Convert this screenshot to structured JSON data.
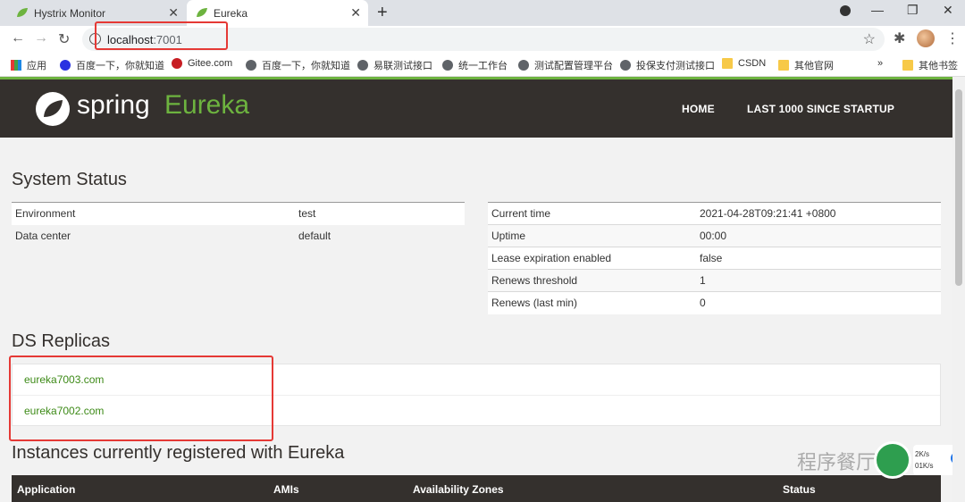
{
  "browser": {
    "tabs": [
      {
        "title": "Hystrix Monitor",
        "active": false
      },
      {
        "title": "Eureka",
        "active": true
      }
    ],
    "url_host": "localhost",
    "url_port": ":7001",
    "bookmarks": [
      {
        "label": "应用",
        "icon": "apps-icon"
      },
      {
        "label": "百度一下，你就知道",
        "icon": "baidu-icon"
      },
      {
        "label": "Gitee.com",
        "icon": "gitee-icon"
      },
      {
        "label": "百度一下，你就知道",
        "icon": "globe-icon"
      },
      {
        "label": "易联测试接口",
        "icon": "globe-icon"
      },
      {
        "label": "统一工作台",
        "icon": "globe-icon"
      },
      {
        "label": "测试配置管理平台",
        "icon": "globe-icon"
      },
      {
        "label": "投保支付测试接口",
        "icon": "globe-icon"
      },
      {
        "label": "CSDN",
        "icon": "folder-icon"
      },
      {
        "label": "其他官网",
        "icon": "folder-icon"
      },
      {
        "label": "其他书签",
        "icon": "folder-icon"
      }
    ],
    "overflow": "»"
  },
  "header": {
    "logo_spring": "spring",
    "logo_eureka": "Eureka",
    "nav": [
      "HOME",
      "LAST 1000 SINCE STARTUP"
    ]
  },
  "system_status": {
    "title": "System Status",
    "left": [
      [
        "Environment",
        "test"
      ],
      [
        "Data center",
        "default"
      ]
    ],
    "right": [
      [
        "Current time",
        "2021-04-28T09:21:41 +0800"
      ],
      [
        "Uptime",
        "00:00"
      ],
      [
        "Lease expiration enabled",
        "false"
      ],
      [
        "Renews threshold",
        "1"
      ],
      [
        "Renews (last min)",
        "0"
      ]
    ]
  },
  "replicas": {
    "title": "DS Replicas",
    "items": [
      "eureka7003.com",
      "eureka7002.com"
    ]
  },
  "instances": {
    "title": "Instances currently registered with Eureka",
    "columns": [
      "Application",
      "AMIs",
      "Availability Zones",
      "Status"
    ]
  },
  "overlay": {
    "watermark": "程序餐厅",
    "net_up": "2K/s",
    "net_down": "01K/s",
    "plus": "+"
  },
  "colors": {
    "brand_green": "#6db33f",
    "navbar": "#34302d",
    "highlight": "#e53935"
  }
}
